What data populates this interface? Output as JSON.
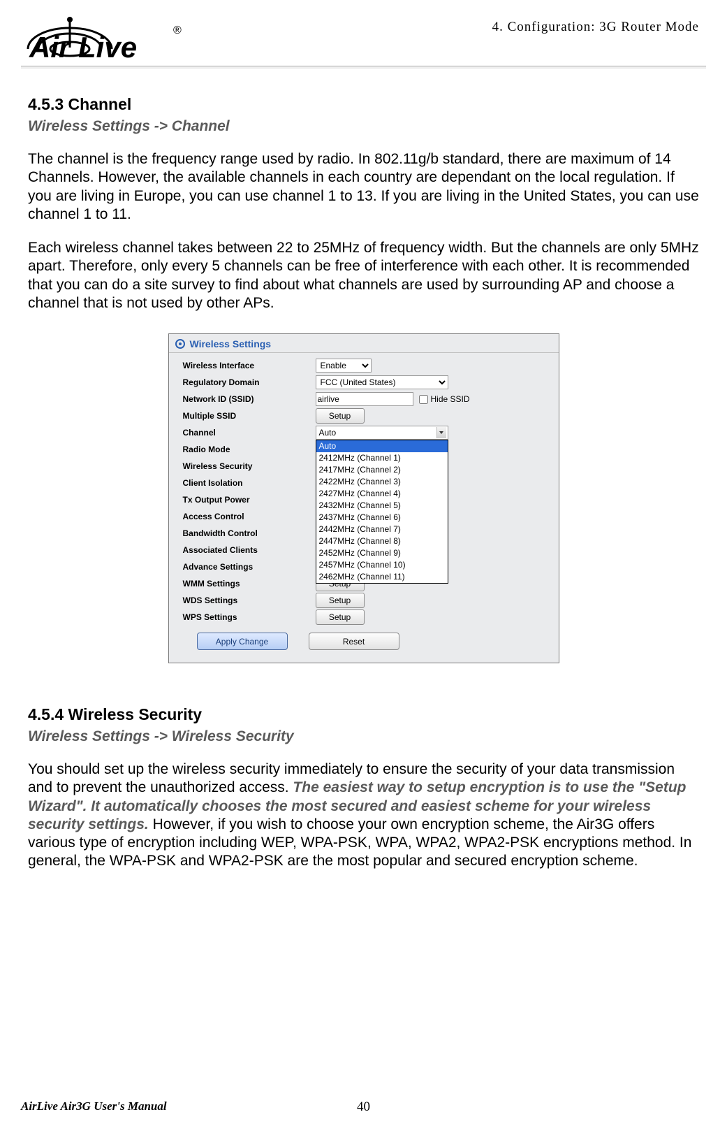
{
  "header": {
    "chapter_label": "4. Configuration: 3G Router Mode",
    "logo_text": "Air Live",
    "logo_reg": "®"
  },
  "section1": {
    "number_title": "4.5.3 Channel",
    "breadcrumb": "Wireless Settings -> Channel",
    "para1": "The channel is the frequency range used by radio.    In 802.11g/b standard, there are maximum of 14 Channels.    However, the available channels in each country are dependant on the local regulation.    If you are living in Europe, you can use channel 1 to 13. If you are living in the United States, you can use channel 1 to 11.",
    "para2": "Each wireless channel takes between 22 to 25MHz of frequency width.    But the channels are only 5MHz apart.    Therefore, only every 5 channels can be free of interference with each other.    It is recommended that you can do a site survey to find about what channels are used by surrounding AP and choose a channel that is not used by other APs."
  },
  "screenshot": {
    "panel_title": "Wireless Settings",
    "rows": {
      "wireless_interface": "Wireless Interface",
      "regulatory_domain": "Regulatory Domain",
      "network_id": "Network ID (SSID)",
      "multiple_ssid": "Multiple SSID",
      "channel": "Channel",
      "radio_mode": "Radio Mode",
      "wireless_security": "Wireless Security",
      "client_isolation": "Client Isolation",
      "tx_output_power": "Tx Output Power",
      "access_control": "Access Control",
      "bandwidth_control": "Bandwidth Control",
      "associated_clients": "Associated Clients",
      "advance_settings": "Advance Settings",
      "wmm_settings": "WMM Settings",
      "wds_settings": "WDS Settings",
      "wps_settings": "WPS Settings"
    },
    "values": {
      "wireless_interface": "Enable",
      "regulatory_domain": "FCC (United States)",
      "network_id": "airlive",
      "hide_ssid_label": "Hide SSID",
      "channel_selected": "Auto",
      "setup_label": "Setup"
    },
    "channel_options": [
      "Auto",
      "2412MHz (Channel 1)",
      "2417MHz (Channel 2)",
      "2422MHz (Channel 3)",
      "2427MHz (Channel 4)",
      "2432MHz (Channel 5)",
      "2437MHz (Channel 6)",
      "2442MHz (Channel 7)",
      "2447MHz (Channel 8)",
      "2452MHz (Channel 9)",
      "2457MHz (Channel 10)",
      "2462MHz (Channel 11)"
    ],
    "buttons": {
      "apply": "Apply Change",
      "reset": "Reset"
    }
  },
  "section2": {
    "number_title": "4.5.4 Wireless Security",
    "breadcrumb": "Wireless Settings -> Wireless Security",
    "para_a": "You should set up the wireless security immediately to ensure the security of your data transmission and to prevent the unauthorized access.    ",
    "para_emph": "The easiest way to setup encryption is to use the \"Setup Wizard\".    It automatically chooses the most secured and easiest scheme for your wireless security settings",
    "para_dot": ".",
    "para_b": "    However, if you wish to choose your own encryption scheme, the Air3G offers various type of encryption including WEP, WPA-PSK, WPA, WPA2, WPA2-PSK encryptions method.    In general, the WPA-PSK and WPA2-PSK are the most popular and secured encryption scheme."
  },
  "footer": {
    "manual": "AirLive Air3G User's Manual",
    "page": "40"
  }
}
